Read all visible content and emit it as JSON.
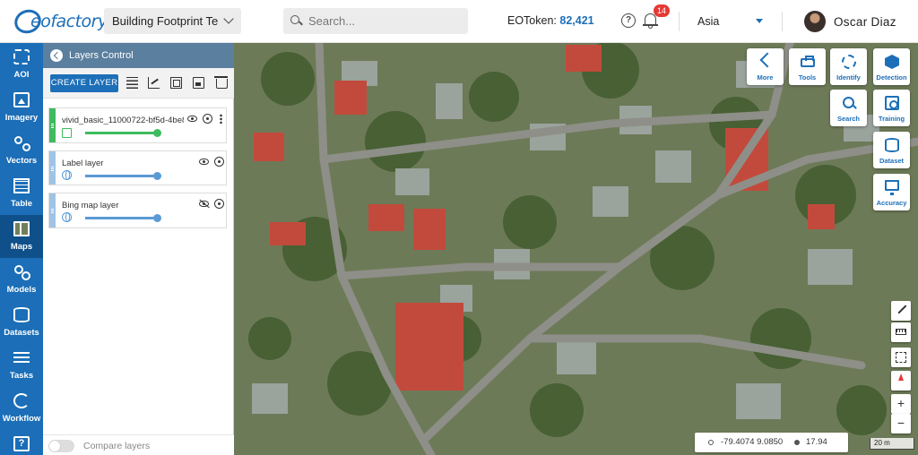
{
  "app": {
    "logo_text": "eofactory",
    "project_name": "Building Footprint Test"
  },
  "search": {
    "placeholder": "Search..."
  },
  "eotoken": {
    "label": "EOToken:",
    "value": "82,421"
  },
  "notifications": {
    "count": "14"
  },
  "region": {
    "selected": "Asia"
  },
  "user": {
    "name": "Oscar Diaz"
  },
  "leftnav": {
    "items": [
      {
        "label": "AOI",
        "icon": "aoi-icon"
      },
      {
        "label": "Imagery",
        "icon": "imagery-icon"
      },
      {
        "label": "Vectors",
        "icon": "vectors-icon"
      },
      {
        "label": "Table",
        "icon": "table-icon"
      },
      {
        "label": "Maps",
        "icon": "maps-icon",
        "active": true
      },
      {
        "label": "Models",
        "icon": "models-icon"
      },
      {
        "label": "Datasets",
        "icon": "datasets-icon"
      },
      {
        "label": "Tasks",
        "icon": "tasks-icon"
      },
      {
        "label": "Workflow",
        "icon": "workflow-icon"
      },
      {
        "label": "?",
        "icon": "help-icon"
      }
    ]
  },
  "layers_panel": {
    "title": "Layers Control",
    "create_button": "CREATE LAYER",
    "layers": [
      {
        "name": "vivid_basic_11000722-bf5d-4be8-...",
        "visible": true,
        "type_icon": "image-layer-icon",
        "opacity": 1.0
      },
      {
        "name": "Label layer",
        "visible": true,
        "type_icon": "globe-icon",
        "opacity": 1.0
      },
      {
        "name": "Bing map layer",
        "visible": false,
        "type_icon": "globe-icon",
        "opacity": 1.0
      }
    ],
    "compare_label": "Compare layers",
    "compare_enabled": false
  },
  "map_tools": {
    "more": "More",
    "tools": "Tools",
    "identify": "Identify",
    "detection": "Detection",
    "search": "Search",
    "training": "Training",
    "dataset": "Dataset",
    "accuracy": "Accuracy"
  },
  "map_controls": {
    "zoom_in": "+",
    "zoom_out": "−"
  },
  "coordinates": {
    "lonlat": "-79.4074  9.0850",
    "zoom": "17.94"
  },
  "scale": {
    "label": "20 m"
  },
  "colors": {
    "brand": "#1b6eb7",
    "panel_header": "#5b7f9e",
    "badge": "#e53935",
    "layer_active": "#3fbb5f"
  }
}
